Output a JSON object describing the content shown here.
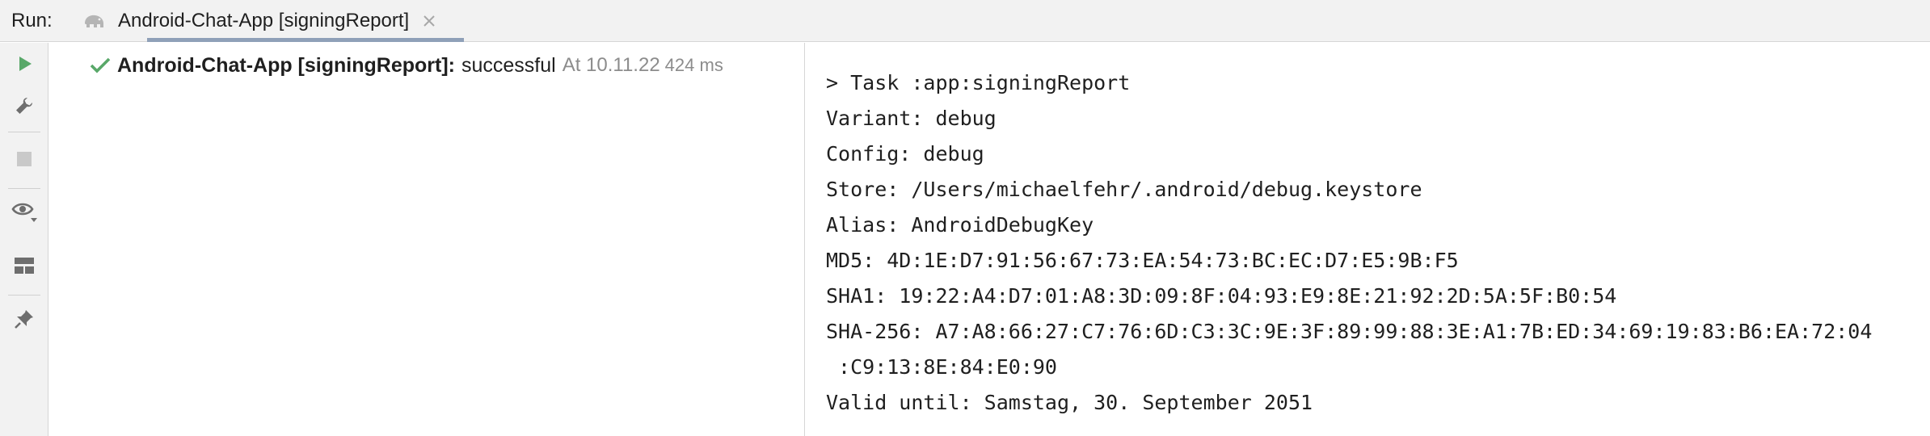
{
  "header": {
    "run_label": "Run:",
    "tab_title": "Android-Chat-App [signingReport]",
    "tab_icon": "gradle-elephant-icon",
    "close_icon": "close-icon"
  },
  "toolbar": {
    "items": [
      {
        "name": "rerun-button",
        "icon": "play-icon"
      },
      {
        "name": "build-settings-button",
        "icon": "wrench-icon"
      },
      {
        "name": "stop-button",
        "icon": "stop-icon"
      },
      {
        "name": "view-options-button",
        "icon": "eye-icon"
      },
      {
        "name": "layout-button",
        "icon": "layout-icon"
      },
      {
        "name": "pin-tab-button",
        "icon": "pin-icon"
      }
    ]
  },
  "tree": {
    "root": {
      "name": "Android-Chat-App [signingReport]:",
      "status": "successful",
      "time": "At 10.11.22",
      "duration": "424 ms",
      "status_color": "#59a869"
    }
  },
  "console": {
    "lines": [
      "> Task :app:signingReport",
      "Variant: debug",
      "Config: debug",
      "Store: /Users/michaelfehr/.android/debug.keystore",
      "Alias: AndroidDebugKey",
      "MD5: 4D:1E:D7:91:56:67:73:EA:54:73:BC:EC:D7:E5:9B:F5",
      "SHA1: 19:22:A4:D7:01:A8:3D:09:8F:04:93:E9:8E:21:92:2D:5A:5F:B0:54",
      "SHA-256: A7:A8:66:27:C7:76:6D:C3:3C:9E:3F:89:99:88:3E:A1:7B:ED:34:69:19:83:B6:EA:72:04",
      " :C9:13:8E:84:E0:90",
      "Valid until: Samstag, 30. September 2051"
    ]
  },
  "colors": {
    "accent_green": "#59a869",
    "tab_underline": "#8fa0b8",
    "icon_gray": "#6e6e6e"
  }
}
